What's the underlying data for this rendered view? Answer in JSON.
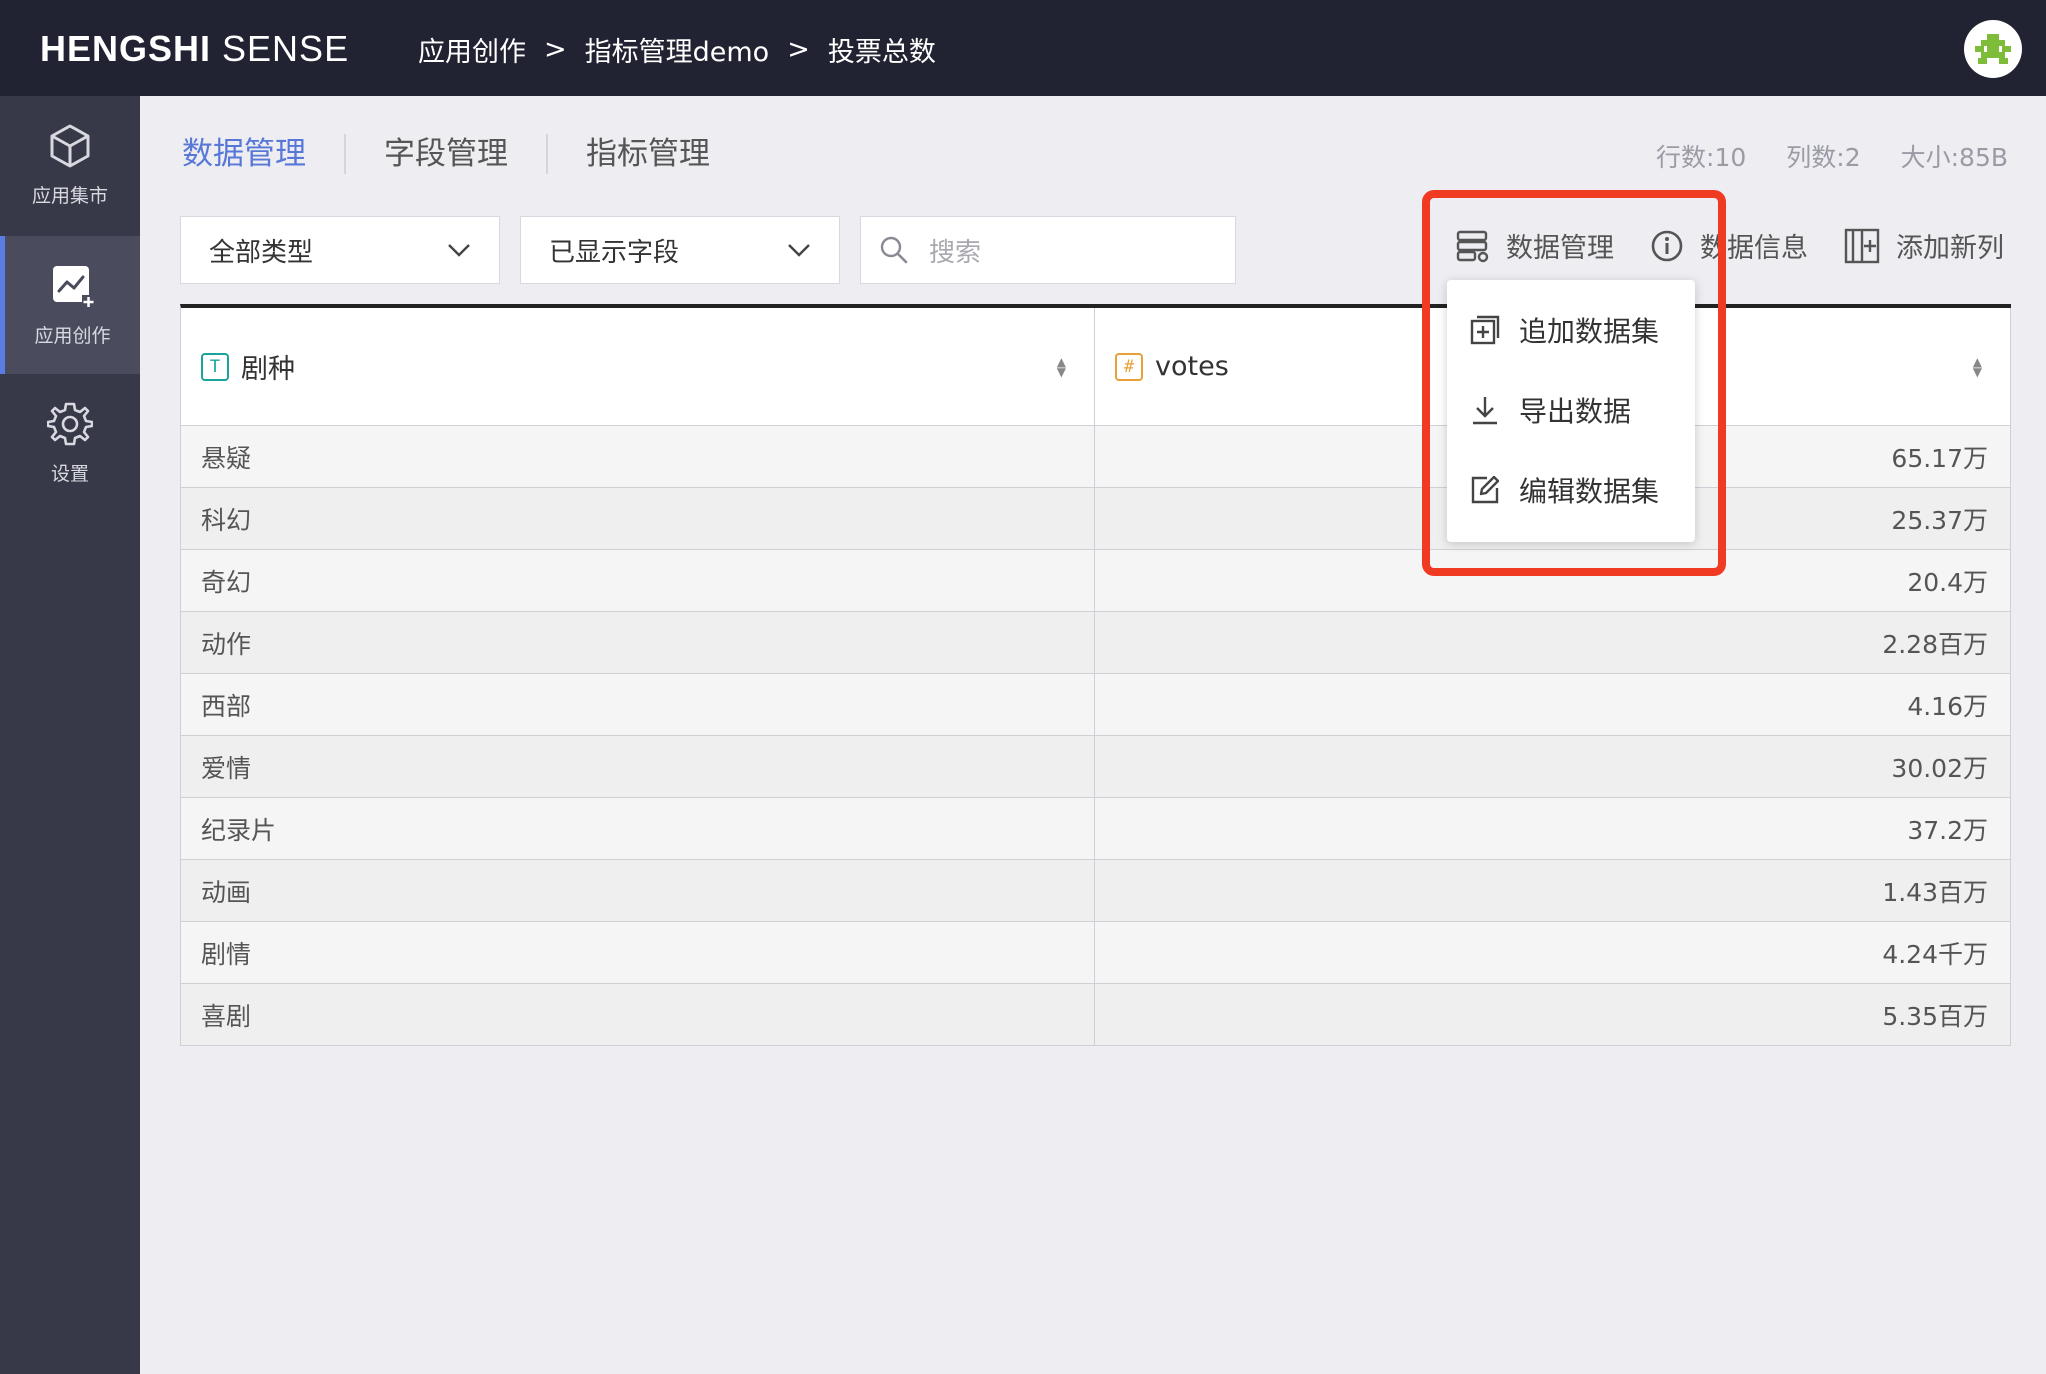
{
  "header": {
    "logo_bold": "HENGSHI",
    "logo_light": " SENSE",
    "breadcrumb": [
      "应用创作",
      "指标管理demo",
      "投票总数"
    ],
    "breadcrumb_sep": ">"
  },
  "sidebar": {
    "items": [
      {
        "label": "应用集市",
        "icon": "cube-icon",
        "active": false
      },
      {
        "label": "应用创作",
        "icon": "chart-add-icon",
        "active": true
      },
      {
        "label": "设置",
        "icon": "gear-icon",
        "active": false
      }
    ]
  },
  "tabs": [
    {
      "label": "数据管理",
      "active": true
    },
    {
      "label": "字段管理",
      "active": false
    },
    {
      "label": "指标管理",
      "active": false
    }
  ],
  "stats": {
    "rows": "行数:10",
    "cols": "列数:2",
    "size": "大小:85B"
  },
  "filters": {
    "type_select": "全部类型",
    "field_select": "已显示字段",
    "search_placeholder": "搜索"
  },
  "toolbar": {
    "data_manage": "数据管理",
    "data_info": "数据信息",
    "add_column": "添加新列"
  },
  "dropdown": {
    "items": [
      "追加数据集",
      "导出数据",
      "编辑数据集"
    ]
  },
  "table": {
    "columns": [
      {
        "name": "剧种",
        "type_badge": "T",
        "type_color": "#1aa39a"
      },
      {
        "name": "votes",
        "type_badge": "#",
        "type_color": "#e8a13a"
      }
    ],
    "rows": [
      [
        "悬疑",
        "65.17万"
      ],
      [
        "科幻",
        "25.37万"
      ],
      [
        "奇幻",
        "20.4万"
      ],
      [
        "动作",
        "2.28百万"
      ],
      [
        "西部",
        "4.16万"
      ],
      [
        "爱情",
        "30.02万"
      ],
      [
        "纪录片",
        "37.2万"
      ],
      [
        "动画",
        "1.43百万"
      ],
      [
        "剧情",
        "4.24千万"
      ],
      [
        "喜剧",
        "5.35百万"
      ]
    ]
  },
  "colors": {
    "topbar": "#222332",
    "sidebar": "#383948",
    "accent": "#5878d8",
    "highlight": "#f03a22",
    "avatar_green": "#7dbd3a"
  }
}
